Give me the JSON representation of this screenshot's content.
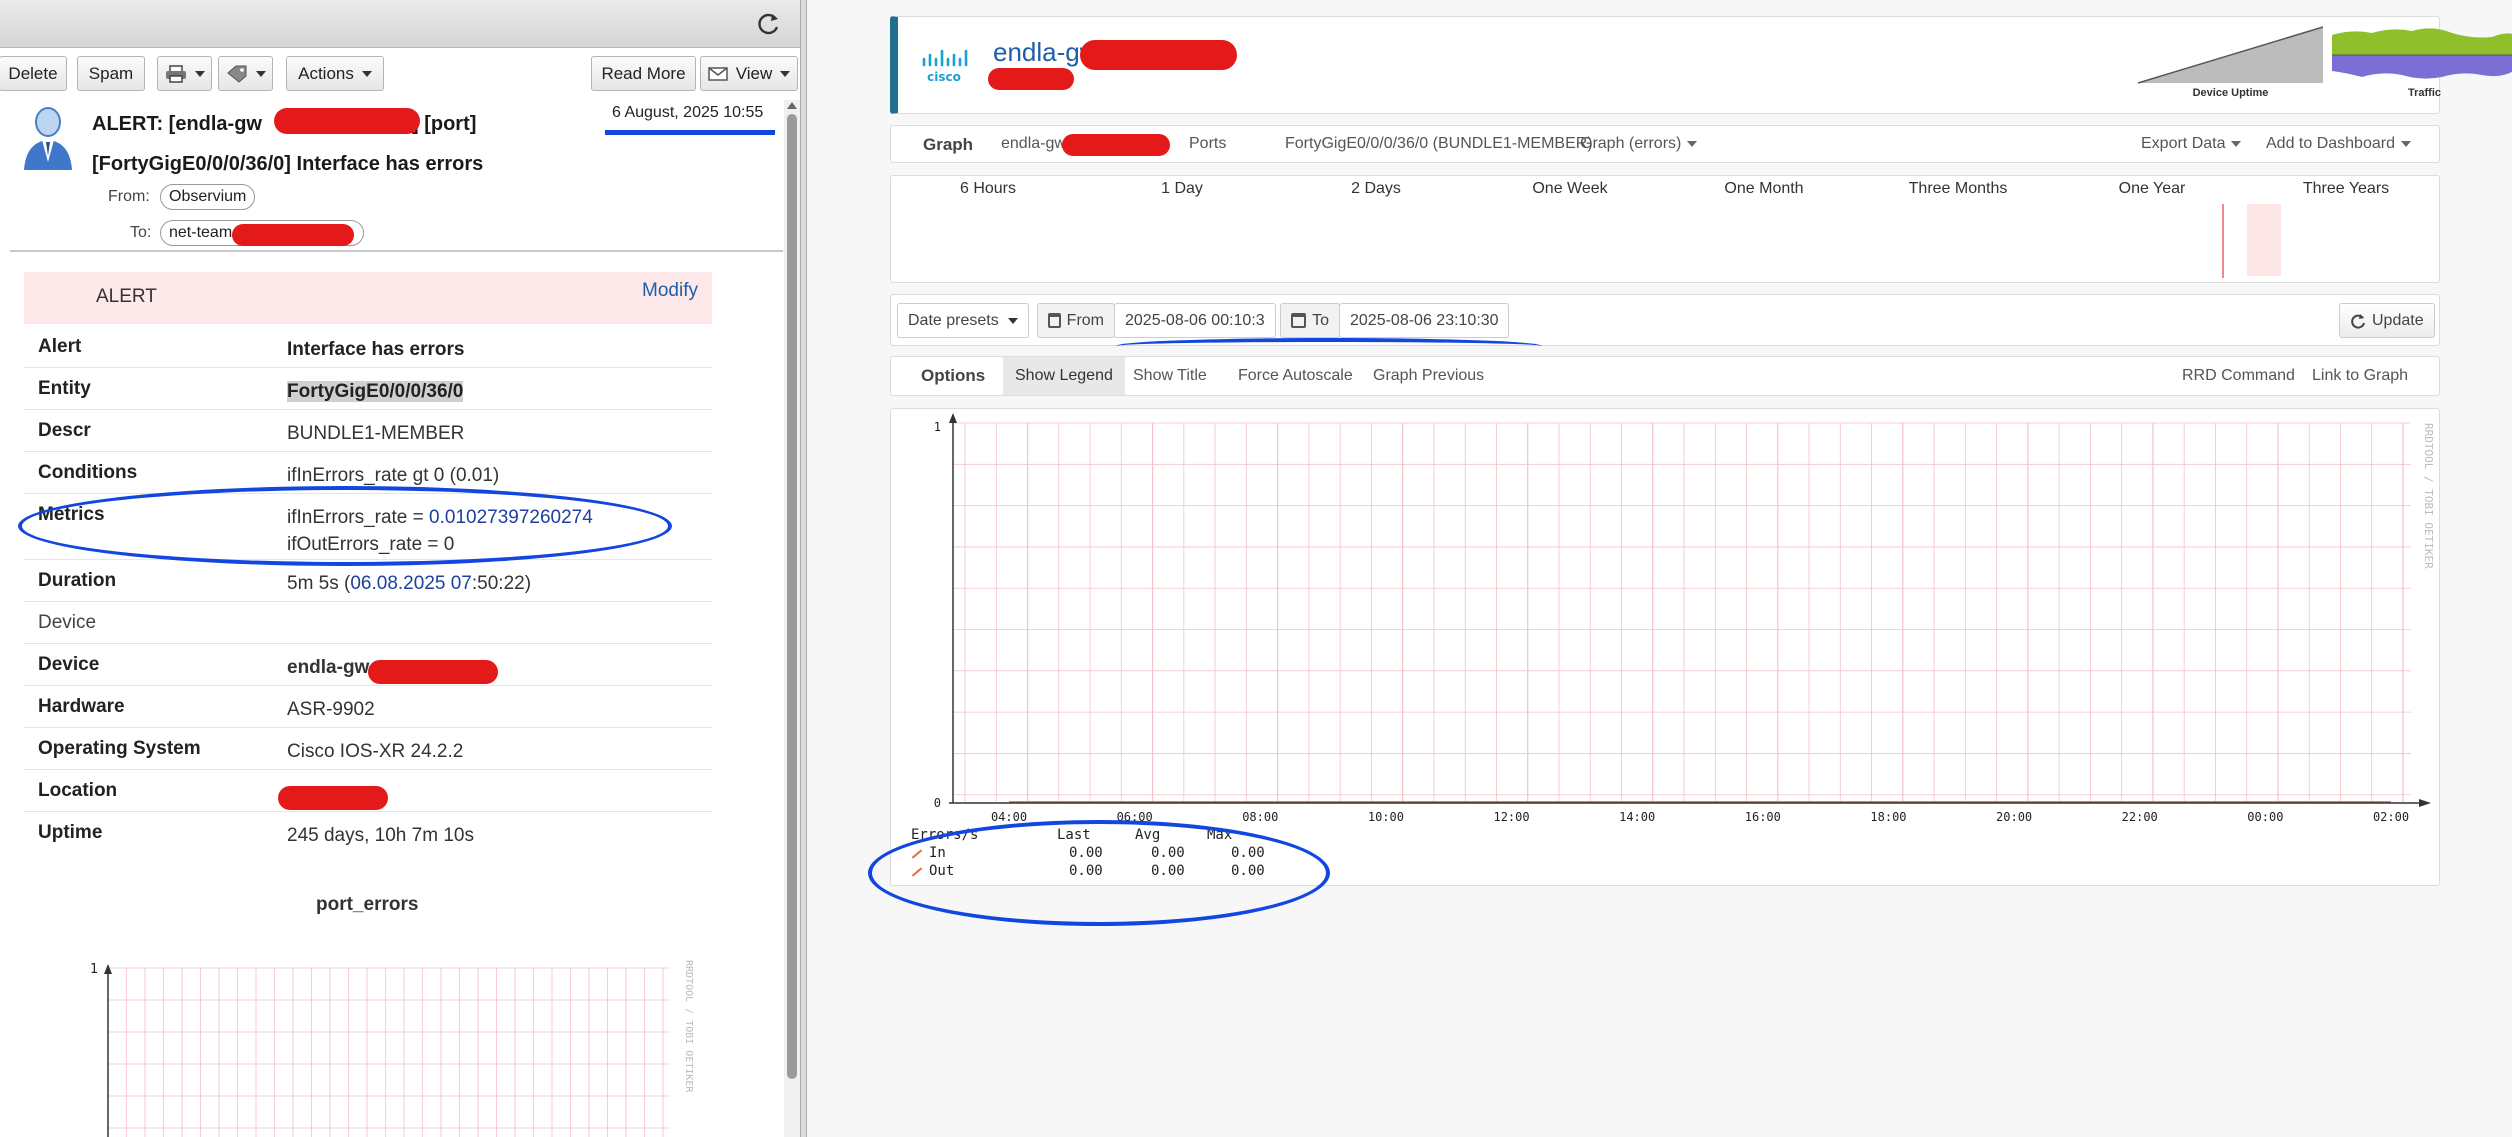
{
  "mail": {
    "toolbar": {
      "delete": "Delete",
      "spam": "Spam",
      "actions": "Actions",
      "read_more": "Read More",
      "view": "View"
    },
    "subject_line1_prefix": "ALERT: [endla-gw",
    "subject_line1_suffix": "] [port]",
    "subject_line2": "[FortyGigE0/0/0/36/0] Interface has errors",
    "date": "6 August, 2025 10:55",
    "from_label": "From:",
    "from_value": "Observium",
    "to_label": "To:",
    "to_value": "net-team"
  },
  "alert": {
    "box_title": "ALERT",
    "modify": "Modify",
    "rows": [
      {
        "key": "Alert",
        "value": "Interface has errors"
      },
      {
        "key": "Entity",
        "value": "FortyGigE0/0/0/36/0"
      },
      {
        "key": "Descr",
        "value": "BUNDLE1-MEMBER"
      },
      {
        "key": "Conditions",
        "value": "ifInErrors_rate gt 0 (0.01)"
      },
      {
        "key": "Metrics",
        "value_line1_key": "ifInErrors_rate = ",
        "value_line1_num": "0.01027397260274",
        "value_line2": "ifOutErrors_rate = 0"
      },
      {
        "key": "Duration",
        "value_prefix": "5m 5s (",
        "value_link": "06.08.2025 07",
        "value_suffix": ":50:22)"
      },
      {
        "key": "Device"
      },
      {
        "key": "Device",
        "value": "endla-gw"
      },
      {
        "key": "Hardware",
        "value": "ASR-9902"
      },
      {
        "key": "Operating System",
        "value": "Cisco IOS-XR 24.2.2"
      },
      {
        "key": "Location",
        "value": ""
      },
      {
        "key": "Uptime",
        "value": "245 days, 10h 7m 10s"
      }
    ],
    "graph_title": "port_errors",
    "graph_ymax": "1",
    "watermark": "RRDTOOL / TOBI OETIKER"
  },
  "observium": {
    "device_name": "endla-gw",
    "uptime_label": "Device Uptime",
    "traffic_label": "Traffic",
    "breadcrumb": {
      "graph": "Graph",
      "device": "endla-gw",
      "ports": "Ports",
      "port": "FortyGigE0/0/0/36/0 (BUNDLE1-MEMBER)",
      "graph_type": "Graph (errors)",
      "export": "Export Data",
      "dashboard": "Add to Dashboard"
    },
    "periods": [
      "6 Hours",
      "1 Day",
      "2 Days",
      "One Week",
      "One Month",
      "Three Months",
      "One Year",
      "Three Years"
    ],
    "range": {
      "presets": "Date presets",
      "from_label": "From",
      "from_value": "2025-08-06 00:10:3",
      "to_label": "To",
      "to_value": "2025-08-06 23:10:30",
      "update": "Update"
    },
    "options": {
      "options": "Options",
      "show_legend": "Show Legend",
      "show_title": "Show Title",
      "force_autoscale": "Force Autoscale",
      "graph_previous": "Graph Previous",
      "rrd_command": "RRD Command",
      "link_to_graph": "Link to Graph"
    },
    "legend": {
      "header": [
        "Errors/s",
        "Last",
        "Avg",
        "Max"
      ],
      "rows": [
        {
          "name": "In",
          "last": "0.00",
          "avg": "0.00",
          "max": "0.00"
        },
        {
          "name": "Out",
          "last": "0.00",
          "avg": "0.00",
          "max": "0.00"
        }
      ]
    },
    "colors": {
      "in_series": "#e86a3a",
      "out_series": "#e86a3a",
      "grid": "#f4c2c8",
      "accent": "#1f6f8f"
    }
  },
  "chart_data": [
    {
      "type": "line",
      "title": "",
      "xlabel": "",
      "ylabel": "",
      "ylim": [
        0,
        1
      ],
      "y_ticks": [
        "0",
        "1"
      ],
      "x": [
        "04:00",
        "06:00",
        "08:00",
        "10:00",
        "12:00",
        "14:00",
        "16:00",
        "18:00",
        "20:00",
        "22:00",
        "00:00",
        "02:00"
      ],
      "series": [
        {
          "name": "In",
          "values": [
            0,
            0,
            0,
            0,
            0,
            0,
            0,
            0,
            0,
            0,
            0,
            0
          ]
        },
        {
          "name": "Out",
          "values": [
            0,
            0,
            0,
            0,
            0,
            0,
            0,
            0,
            0,
            0,
            0,
            0
          ]
        }
      ],
      "grid": true,
      "legend": "bottom-left"
    }
  ]
}
